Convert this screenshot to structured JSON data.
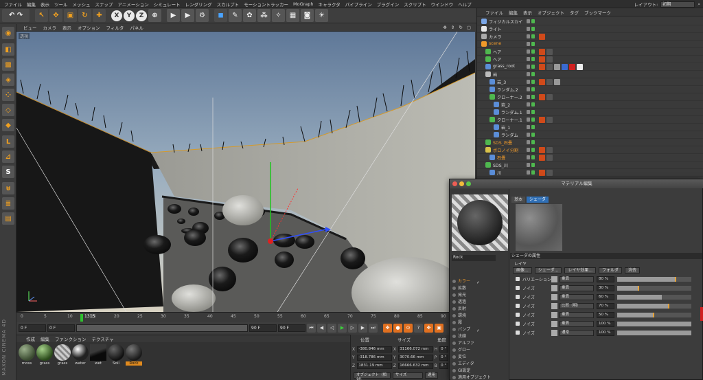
{
  "menubar": {
    "items": [
      "ファイル",
      "編集",
      "表示",
      "ツール",
      "メッシュ",
      "スナップ",
      "アニメーション",
      "シミュレート",
      "レンダリング",
      "スカルプト",
      "モーショントラッカー",
      "MoGraph",
      "キャラクタ",
      "パイプライン",
      "プラグイン",
      "スクリプト",
      "ウインドウ",
      "ヘルプ"
    ],
    "layout_label": "レイアウト:",
    "layout_value": "初期"
  },
  "toolbar": {
    "axes": [
      "X",
      "Y",
      "Z"
    ]
  },
  "brand": "MAXON CINEMA 4D",
  "viewport": {
    "menu": [
      "ビュー",
      "カメラ",
      "表示",
      "オプション",
      "フィルタ",
      "パネル"
    ],
    "label": "透視"
  },
  "timeline": {
    "ticks": [
      "0",
      "5",
      "10",
      "15",
      "20",
      "25",
      "30",
      "35",
      "40",
      "45",
      "50",
      "55",
      "60",
      "65",
      "70",
      "75",
      "80",
      "85",
      "90"
    ],
    "current_frame": "1315",
    "start_field": "0 F",
    "min_field": "0 F",
    "max_field": "90 F",
    "end_field": "90 F"
  },
  "materials": {
    "menu": [
      "作成",
      "編集",
      "ファンクション",
      "テクスチャ"
    ],
    "items": [
      "moss",
      "grass",
      "grass",
      "water",
      "wet",
      "Soil",
      "Rock"
    ],
    "selected_index": 6
  },
  "coords": {
    "headers": [
      "位置",
      "サイズ",
      "角度"
    ],
    "rows": [
      {
        "axis": "X",
        "pos": "-380.846 mm",
        "size_axis": "X",
        "size": "31166.072 mm",
        "rot_axis": "H",
        "rot": "0 °"
      },
      {
        "axis": "Y",
        "pos": "-318.786 mm",
        "size_axis": "Y",
        "size": "3070.66 mm",
        "rot_axis": "P",
        "rot": "0 °"
      },
      {
        "axis": "Z",
        "pos": "1831.19 mm",
        "size_axis": "Z",
        "size": "16666.632 mm",
        "rot_axis": "B",
        "rot": "0 °"
      }
    ],
    "mode_select": "オブジェクト（相対）",
    "size_select": "サイズ",
    "apply_button": "適用"
  },
  "object_manager": {
    "menu": [
      "ファイル",
      "編集",
      "表示",
      "オブジェクト",
      "タグ",
      "ブックマーク"
    ],
    "rows": [
      {
        "name": "フィジカルスカイ",
        "indent": 0,
        "orange": false,
        "tags": 0,
        "icon": "#7aa6e6"
      },
      {
        "name": "ライト",
        "indent": 0,
        "orange": false,
        "tags": 0,
        "icon": "#e8e8e8"
      },
      {
        "name": "カメラ",
        "indent": 0,
        "orange": false,
        "tags": 1,
        "icon": "#aaaaaa"
      },
      {
        "name": "scene",
        "indent": 0,
        "orange": true,
        "tags": 0,
        "icon": "#f09a2a"
      },
      {
        "name": "ヘア",
        "indent": 1,
        "orange": false,
        "tags": 2,
        "icon": "#4fb84f"
      },
      {
        "name": "ヘア",
        "indent": 1,
        "orange": false,
        "tags": 2,
        "icon": "#4fb84f"
      },
      {
        "name": "grass_root",
        "indent": 1,
        "orange": false,
        "tags": 6,
        "icon": "#5b8ed8"
      },
      {
        "name": "岩",
        "indent": 1,
        "orange": false,
        "tags": 0,
        "icon": "#bbbbbb"
      },
      {
        "name": "岩_3",
        "indent": 2,
        "orange": false,
        "tags": 3,
        "icon": "#5b8ed8"
      },
      {
        "name": "ランダム.2",
        "indent": 2,
        "orange": false,
        "tags": 0,
        "icon": "#5b8ed8"
      },
      {
        "name": "クローナー.2",
        "indent": 2,
        "orange": false,
        "tags": 2,
        "icon": "#4fb84f"
      },
      {
        "name": "岩_2",
        "indent": 3,
        "orange": false,
        "tags": 0,
        "icon": "#5b8ed8"
      },
      {
        "name": "ランダム.1",
        "indent": 3,
        "orange": false,
        "tags": 0,
        "icon": "#5b8ed8"
      },
      {
        "name": "クローナー.1",
        "indent": 2,
        "orange": false,
        "tags": 2,
        "icon": "#4fb84f"
      },
      {
        "name": "岩_1",
        "indent": 3,
        "orange": false,
        "tags": 0,
        "icon": "#5b8ed8"
      },
      {
        "name": "ランダム",
        "indent": 3,
        "orange": false,
        "tags": 0,
        "icon": "#5b8ed8"
      },
      {
        "name": "SDS_石畳",
        "indent": 1,
        "orange": true,
        "tags": 0,
        "icon": "#4fb84f"
      },
      {
        "name": "ボロノイ分割",
        "indent": 1,
        "orange": true,
        "tags": 2,
        "icon": "#d8c24a"
      },
      {
        "name": "石畳",
        "indent": 2,
        "orange": true,
        "tags": 2,
        "icon": "#5b8ed8"
      },
      {
        "name": "SDS_川",
        "indent": 1,
        "orange": false,
        "tags": 0,
        "icon": "#4fb84f"
      },
      {
        "name": "川",
        "indent": 2,
        "orange": false,
        "tags": 2,
        "icon": "#5b8ed8"
      }
    ]
  },
  "material_editor": {
    "title": "マテリアル編集",
    "material_name": "Rock",
    "channels": [
      {
        "name": "カラー",
        "on": true,
        "check": "✓"
      },
      {
        "name": "拡散",
        "on": false,
        "check": ""
      },
      {
        "name": "発光",
        "on": false,
        "check": ""
      },
      {
        "name": "透過",
        "on": false,
        "check": ""
      },
      {
        "name": "反射",
        "on": false,
        "check": ""
      },
      {
        "name": "環境",
        "on": false,
        "check": ""
      },
      {
        "name": "霧",
        "on": false,
        "check": ""
      },
      {
        "name": "バンプ",
        "on": false,
        "check": "✓"
      },
      {
        "name": "法線",
        "on": false,
        "check": ""
      },
      {
        "name": "アルファ",
        "on": false,
        "check": ""
      },
      {
        "name": "グロー",
        "on": false,
        "check": ""
      },
      {
        "name": "変位",
        "on": false,
        "check": ""
      },
      {
        "name": "エディタ",
        "on": false,
        "check": ""
      },
      {
        "name": "GI設定",
        "on": false,
        "check": ""
      },
      {
        "name": "適用オブジェクト",
        "on": false,
        "check": ""
      }
    ],
    "tabs": [
      "基本",
      "シェーダ"
    ],
    "active_tab": 1,
    "section_title": "シェーダの属性",
    "layer_label": "レイヤ",
    "buttons": [
      "画像...",
      "シェーダ...",
      "レイヤ効果...",
      "フォルダ",
      "消去"
    ],
    "layers": [
      {
        "name": "バリエーション",
        "mode": "乗算",
        "pct": "80 %",
        "value": 0.8,
        "tip": true
      },
      {
        "name": "ノイズ",
        "mode": "乗算",
        "pct": "30 %",
        "value": 0.3,
        "tip": true
      },
      {
        "name": "ノイズ",
        "mode": "乗算",
        "pct": "60 %",
        "value": 0.6,
        "tip": false
      },
      {
        "name": "ノイズ",
        "mode": "比較（明）",
        "pct": "70 %",
        "value": 0.7,
        "tip": true
      },
      {
        "name": "ノイズ",
        "mode": "乗算",
        "pct": "50 %",
        "value": 0.5,
        "tip": true
      },
      {
        "name": "ノイズ",
        "mode": "乗算",
        "pct": "100 %",
        "value": 1.0,
        "tip": false
      },
      {
        "name": "ノイズ",
        "mode": "通常",
        "pct": "100 %",
        "value": 1.0,
        "tip": false
      }
    ]
  }
}
